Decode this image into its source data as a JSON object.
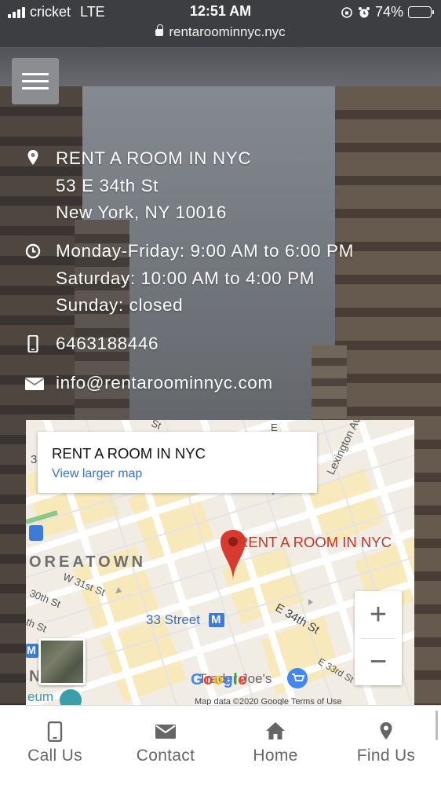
{
  "status_bar": {
    "carrier": "cricket",
    "network": "LTE",
    "time": "12:51 AM",
    "url": "rentaroominnyc.nyc",
    "battery": "74%",
    "battery_level": 0.74
  },
  "contact": {
    "name": "RENT A ROOM IN NYC",
    "address_line1": "53 E 34th St",
    "address_line2": "New York, NY 10016",
    "hours_weekday": "Monday-Friday: 9:00 AM to 6:00 PM",
    "hours_saturday": "Saturday: 10:00 AM to 4:00 PM",
    "hours_sunday": "Sunday: closed",
    "phone": "6463188446",
    "email": "info@rentaroominnyc.com"
  },
  "map": {
    "card_title": "RENT A ROOM IN NYC",
    "card_link": "View larger map",
    "marker_label": "RENT A ROOM IN NYC",
    "street_labels": {
      "lexington": "Lexington Ave",
      "koreatown": "OREATOWN",
      "w31": "W 31st St",
      "w30": "30th St",
      "e34": "E 34th St",
      "e33": "E 33rd St",
      "station": "33 Street",
      "traderjoes": "Trader Joe's",
      "district": "N   A D",
      "museum": "eum",
      "left_edge_a": "3",
      "left_edge_b": "th St",
      "top_st": "St",
      "top_e": "E"
    },
    "zoom_in": "+",
    "zoom_out": "−",
    "google": "Google",
    "attribution": "Map data ©2020 Google   Terms of Use",
    "transit_badge": "M"
  },
  "nav": [
    {
      "label": "Call Us",
      "icon": "phone-icon"
    },
    {
      "label": "Contact",
      "icon": "envelope-icon"
    },
    {
      "label": "Home",
      "icon": "home-icon"
    },
    {
      "label": "Find Us",
      "icon": "map-pin-icon"
    }
  ],
  "colors": {
    "map_marker": "#d93a2f",
    "map_label": "#c5352a",
    "link": "#3a73c8",
    "nav_icon": "#666666"
  }
}
